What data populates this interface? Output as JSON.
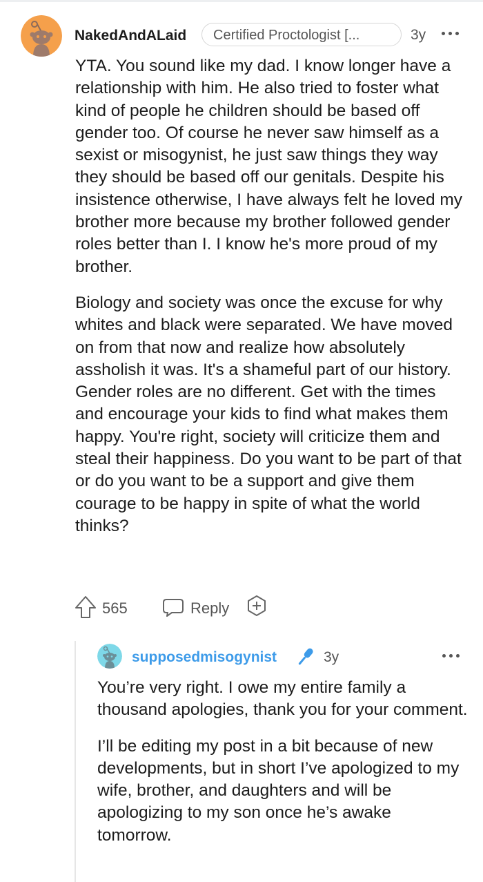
{
  "comment": {
    "username": "NakedAndALaid",
    "flair": "Certified Proctologist [...",
    "age": "3y",
    "paragraphs": [
      "YTA. You sound like my dad. I know longer have a relationship with him. He also tried to foster what kind of people he children should be based off gender too. Of course he never saw himself as a sexist or misogynist, he just saw things they way they should be based off our genitals. Despite his insistence otherwise, I have always felt he loved my brother more because my brother followed gender roles better than I. I know he's more proud of my brother.",
      "Biology and society was once the excuse for why whites and black were separated. We have moved on from that now and realize how absolutely assholish it was. It's a shameful part of our history. Gender roles are no different. Get with the times and encourage your kids to find what makes them happy. You're right, society will criticize them and steal their happiness. Do you want to be part of that or do you want to be a support and give them courage to be happy in spite of what the world thinks?"
    ],
    "score": "565",
    "reply_label": "Reply",
    "avatar_color": "#f5a04b"
  },
  "reply": {
    "username": "supposedmisogynist",
    "age": "3y",
    "username_color": "#3d9be9",
    "avatar_color": "#7ed8e8",
    "paragraphs": [
      "You’re very right. I owe my entire family a thousand apologies, thank you for your comment.",
      "I’ll be editing my post in a bit because of new developments, but in short I’ve apologized to my wife, brother, and daughters and will be apologizing to my son once he’s awake tomorrow."
    ]
  },
  "icons": {
    "upvote": "upvote-arrow-icon",
    "reply": "speech-bubble-icon",
    "award": "award-plus-icon",
    "more": "more-dots-icon",
    "op_badge": "microphone-icon"
  }
}
